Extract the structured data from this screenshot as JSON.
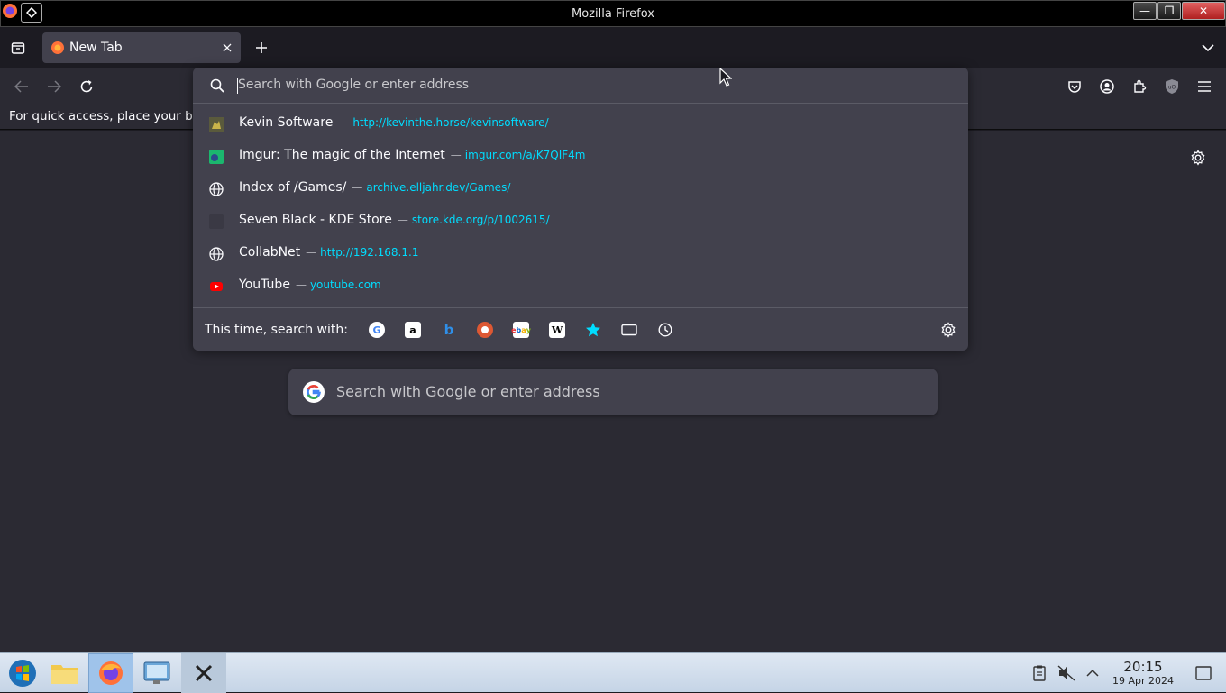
{
  "window": {
    "title": "Mozilla Firefox"
  },
  "tabs": [
    {
      "label": "New Tab"
    }
  ],
  "bookmarks_bar": {
    "text": "For quick access, place your bo"
  },
  "urlbar": {
    "placeholder": "Search with Google or enter address",
    "results": [
      {
        "title": "Kevin Software",
        "url": "http://kevinthe.horse/kevinsoftware/",
        "icon": "site-favicon"
      },
      {
        "title": "Imgur: The magic of the Internet",
        "url": "imgur.com/a/K7QIF4m",
        "icon": "imgur-favicon"
      },
      {
        "title": "Index of /Games/",
        "url": "archive.elljahr.dev/Games/",
        "icon": "globe-icon"
      },
      {
        "title": "Seven Black - KDE Store",
        "url": "store.kde.org/p/1002615/",
        "icon": "kde-favicon"
      },
      {
        "title": "CollabNet",
        "url": "http://192.168.1.1",
        "icon": "globe-icon"
      },
      {
        "title": "YouTube",
        "url": "youtube.com",
        "icon": "youtube-icon"
      }
    ],
    "separator": "—",
    "search_with_label": "This time, search with:",
    "engines": [
      "google",
      "amazon",
      "bing",
      "duckduckgo",
      "ebay",
      "wikipedia",
      "bookmarks",
      "tabs",
      "history"
    ]
  },
  "newtab": {
    "search_placeholder": "Search with Google or enter address"
  },
  "taskbar": {
    "time": "20:15",
    "date": "19 Apr 2024"
  },
  "colors": {
    "accent_url": "#00ddff",
    "panel": "#42414d",
    "toolbar": "#2b2a33"
  }
}
